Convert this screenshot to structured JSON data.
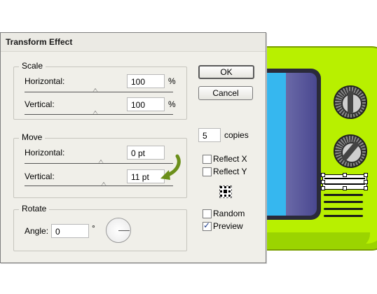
{
  "dialog": {
    "title": "Transform Effect",
    "scale": {
      "legend": "Scale",
      "horizontal_label": "Horizontal:",
      "horizontal_value": "100",
      "horizontal_unit": "%",
      "vertical_label": "Vertical:",
      "vertical_value": "100",
      "vertical_unit": "%"
    },
    "move": {
      "legend": "Move",
      "horizontal_label": "Horizontal:",
      "horizontal_value": "0 pt",
      "vertical_label": "Vertical:",
      "vertical_value": "11 pt"
    },
    "rotate": {
      "legend": "Rotate",
      "angle_label": "Angle:",
      "angle_value": "0",
      "angle_unit": "°"
    },
    "buttons": {
      "ok": "OK",
      "cancel": "Cancel"
    },
    "copies": {
      "value": "5",
      "label": "copies"
    },
    "options": {
      "reflect_x": {
        "label": "Reflect X",
        "checked": false
      },
      "reflect_y": {
        "label": "Reflect Y",
        "checked": false
      },
      "random": {
        "label": "Random",
        "checked": false
      },
      "preview": {
        "label": "Preview",
        "checked": true
      }
    }
  },
  "colors": {
    "tv_body": "#b8f000",
    "screen_blue": "#2ba4e0",
    "screen_purple": "#4a4890",
    "annotation_arrow": "#6b8f1a"
  },
  "icons": [
    "annotation-arrow-icon",
    "reference-point-icon",
    "angle-dial-icon",
    "checkmark-icon"
  ]
}
